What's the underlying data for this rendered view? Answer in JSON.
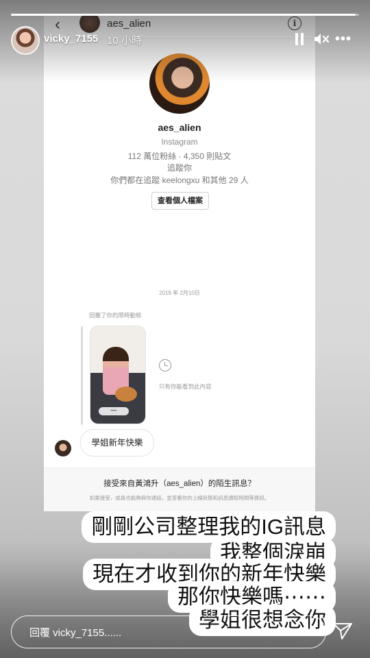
{
  "story": {
    "username": "vicky_7155",
    "time_ago": "10 小時",
    "progress": 0.99,
    "reply_placeholder": "回覆 vicky_7155......"
  },
  "screenshot": {
    "header_username": "aes_alien",
    "profile": {
      "name": "aes_alien",
      "platform": "Instagram",
      "stats": "112 萬位粉絲 · 4,350 則貼文",
      "follows_you": "追蹤你",
      "mutual": "你們都在追蹤 keelongxu 和其他 29 人",
      "view_profile_button": "查看個人檔案"
    },
    "date": "2019 年 2月10日",
    "replied_label": "回覆了你的限時動態",
    "only_you_text": "只有你能看到此內容",
    "message": "學姐新年快樂",
    "request_title": "接受來自黃鴻升（aes_alien）的陌生訊息？",
    "request_sub": "如果接受，成員也能夠與你通話，並查看你的上線狀態和訊息讀取時間等資訊。"
  },
  "captions": [
    "剛剛公司整理我的IG訊息",
    "我整個淚崩",
    "現在才收到你的新年快樂",
    "那你快樂嗎⋯⋯",
    "學姐很想念你"
  ]
}
